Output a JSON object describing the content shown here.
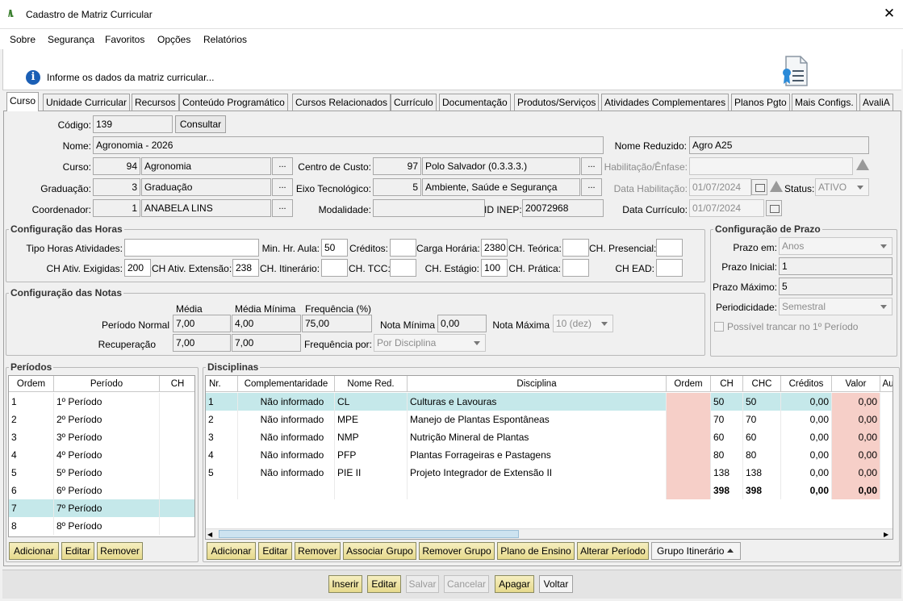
{
  "window": {
    "title": "Cadastro de Matriz Curricular"
  },
  "menu": [
    "Sobre",
    "Segurança",
    "Favoritos",
    "Opções",
    "Relatórios"
  ],
  "info": {
    "text": "Informe os dados da matriz curricular..."
  },
  "tabs": [
    "Curso",
    "Unidade Curricular",
    "Recursos",
    "Conteúdo Programático",
    "Cursos Relacionados",
    "Currículo",
    "Documentação",
    "Produtos/Serviços",
    "Atividades Complementares",
    "Planos Pgto",
    "Mais Configs.",
    "AvaliA"
  ],
  "form": {
    "codigo_label": "Código:",
    "codigo": "139",
    "consultar": "Consultar",
    "nome_label": "Nome:",
    "nome": "Agronomia - 2026",
    "nome_reduzido_label": "Nome Reduzido:",
    "nome_reduzido": "Agro A25",
    "curso_label": "Curso:",
    "curso_id": "94",
    "curso": "Agronomia",
    "centro_label": "Centro de Custo:",
    "centro_id": "97",
    "centro": "Polo Salvador (0.3.3.3.)",
    "habil_label": "Habilitação/Ênfase:",
    "grad_label": "Graduação:",
    "grad_id": "3",
    "grad": "Graduação",
    "eixo_label": "Eixo Tecnológico:",
    "eixo_id": "5",
    "eixo": "Ambiente, Saúde e Segurança",
    "data_hab_label": "Data Habilitação:",
    "data_hab": "01/07/2024",
    "status_label": "Status:",
    "status": "ATIVO",
    "coord_label": "Coordenador:",
    "coord_id": "1",
    "coord": "ANABELA LINS",
    "modal_label": "Modalidade:",
    "inep_label": "ID INEP:",
    "inep": "20072968",
    "data_curr_label": "Data Currículo:",
    "data_curr": "01/07/2024",
    "ellipsis": "..."
  },
  "horas": {
    "title": "Configuração das Horas",
    "tipo_label": "Tipo Horas Atividades:",
    "min_hr_label": "Min. Hr. Aula:",
    "min_hr": "50",
    "creditos_label": "Créditos:",
    "carga_label": "Carga Horária:",
    "carga": "2380",
    "ch_teorica_label": "CH. Teórica:",
    "ch_presencial_label": "CH. Presencial:",
    "ch_exig_label": "CH Ativ. Exigidas:",
    "ch_exig": "200",
    "ch_ext_label": "CH Ativ. Extensão:",
    "ch_ext": "238",
    "ch_itin_label": "CH. Itinerário:",
    "ch_tcc_label": "CH. TCC:",
    "ch_estagio_label": "CH. Estágio:",
    "ch_estagio": "100",
    "ch_pratica_label": "CH. Prática:",
    "ch_ead_label": "CH EAD:"
  },
  "notas": {
    "title": "Configuração das Notas",
    "media_h": "Média",
    "media_min_h": "Média Mínima",
    "freq_h": "Frequência (%)",
    "periodo_normal": "Período Normal",
    "pn_media": "7,00",
    "pn_media_min": "4,00",
    "pn_freq": "75,00",
    "nota_min_label": "Nota Mínima",
    "nota_min": "0,00",
    "nota_max_label": "Nota Máxima",
    "nota_max": "10 (dez)",
    "recuperacao": "Recuperação",
    "rec_media": "7,00",
    "rec_media_min": "7,00",
    "freq_por_label": "Frequência por:",
    "freq_por": "Por Disciplina"
  },
  "prazo": {
    "title": "Configuração de Prazo",
    "prazo_em_label": "Prazo em:",
    "prazo_em": "Anos",
    "prazo_ini_label": "Prazo Inicial:",
    "prazo_ini": "1",
    "prazo_max_label": "Prazo Máximo:",
    "prazo_max": "5",
    "period_label": "Periodicidade:",
    "period": "Semestral",
    "trancar": "Possível trancar no 1º Período"
  },
  "periodos": {
    "title": "Períodos",
    "headers": [
      "Ordem",
      "Período",
      "CH"
    ],
    "rows": [
      [
        "1",
        "1º Período",
        ""
      ],
      [
        "2",
        "2º Período",
        ""
      ],
      [
        "3",
        "3º Período",
        ""
      ],
      [
        "4",
        "4º Período",
        ""
      ],
      [
        "5",
        "5º Período",
        ""
      ],
      [
        "6",
        "6º Período",
        ""
      ],
      [
        "7",
        "7º Período",
        ""
      ],
      [
        "8",
        "8º Período",
        ""
      ]
    ],
    "selected": 6,
    "buttons": [
      "Adicionar",
      "Editar",
      "Remover"
    ]
  },
  "disciplinas": {
    "title": "Disciplinas",
    "headers": [
      "Nr.",
      "Complementaridade",
      "Nome Red.",
      "Disciplina",
      "Ordem",
      "CH",
      "CHC",
      "Créditos",
      "Valor",
      "Au"
    ],
    "rows": [
      [
        "1",
        "Não informado",
        "CL",
        "Culturas e Lavouras",
        "",
        "50",
        "50",
        "0,00",
        "0,00"
      ],
      [
        "2",
        "Não informado",
        "MPE",
        "Manejo de Plantas Espontâneas",
        "",
        "70",
        "70",
        "0,00",
        "0,00"
      ],
      [
        "3",
        "Não informado",
        "NMP",
        "Nutrição Mineral de Plantas",
        "",
        "60",
        "60",
        "0,00",
        "0,00"
      ],
      [
        "4",
        "Não informado",
        "PFP",
        "Plantas Forrageiras e Pastagens",
        "",
        "80",
        "80",
        "0,00",
        "0,00"
      ],
      [
        "5",
        "Não informado",
        "PIE II",
        "Projeto Integrador de Extensão II",
        "",
        "138",
        "138",
        "0,00",
        "0,00"
      ]
    ],
    "totals": [
      "",
      "",
      "",
      "",
      "",
      "398",
      "398",
      "0,00",
      "0,00"
    ],
    "buttons": [
      "Adicionar",
      "Editar",
      "Remover",
      "Associar Grupo",
      "Remover Grupo",
      "Plano de Ensino",
      "Alterar Período"
    ],
    "grupo_btn": "Grupo Itinerário"
  },
  "footer": [
    "Inserir",
    "Editar",
    "Salvar",
    "Cancelar",
    "Apagar",
    "Voltar"
  ],
  "colors": {
    "selected_row": "#c5e8ea",
    "pink_cell": "#f6cfc8",
    "button_yellow": "#efe3a6"
  }
}
